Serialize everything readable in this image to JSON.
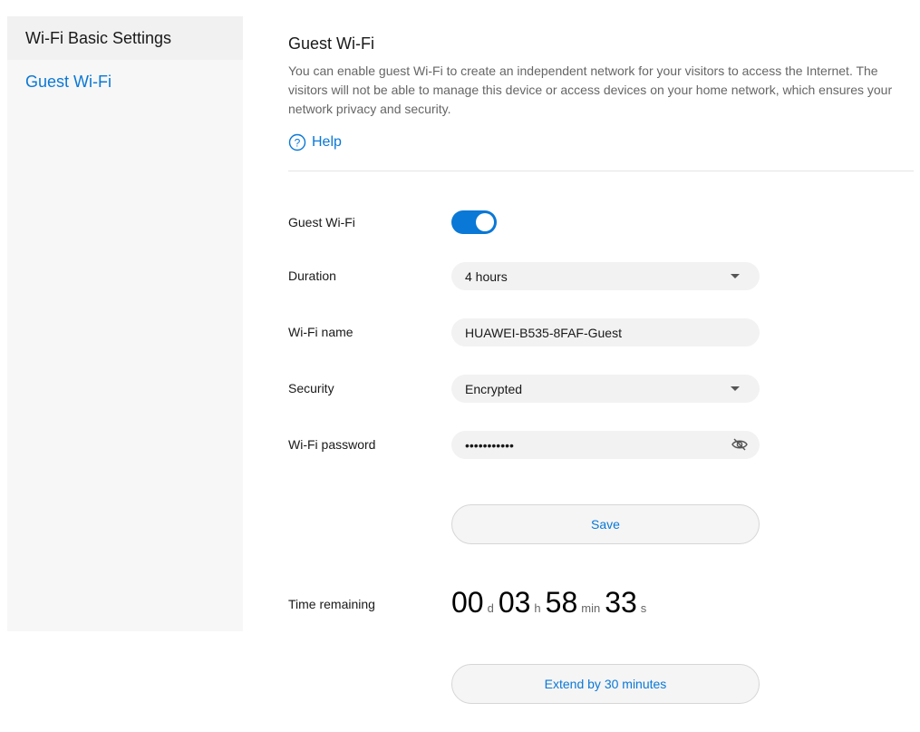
{
  "sidebar": {
    "items": [
      {
        "label": "Wi-Fi Basic Settings"
      },
      {
        "label": "Guest Wi-Fi"
      }
    ]
  },
  "main": {
    "title": "Guest Wi-Fi",
    "description": "You can enable guest Wi-Fi to create an independent network for your visitors to access the Internet. The visitors will not be able to manage this device or access devices on your home network, which ensures your network privacy and security.",
    "help_label": "Help"
  },
  "form": {
    "guest_wifi": {
      "label": "Guest Wi-Fi",
      "enabled": true
    },
    "duration": {
      "label": "Duration",
      "value": "4 hours"
    },
    "wifi_name": {
      "label": "Wi-Fi name",
      "value": "HUAWEI-B535-8FAF-Guest"
    },
    "security": {
      "label": "Security",
      "value": "Encrypted"
    },
    "wifi_password": {
      "label": "Wi-Fi password",
      "value": "•••••••••••"
    },
    "save_label": "Save"
  },
  "timer": {
    "label": "Time remaining",
    "days": "00",
    "days_unit": "d",
    "hours": "03",
    "hours_unit": "h",
    "minutes": "58",
    "minutes_unit": "min",
    "seconds": "33",
    "seconds_unit": "s",
    "extend_label": "Extend by 30 minutes"
  },
  "colors": {
    "accent": "#0a78d6",
    "field_bg": "#f2f2f2",
    "sidebar_bg": "#f7f7f7"
  }
}
